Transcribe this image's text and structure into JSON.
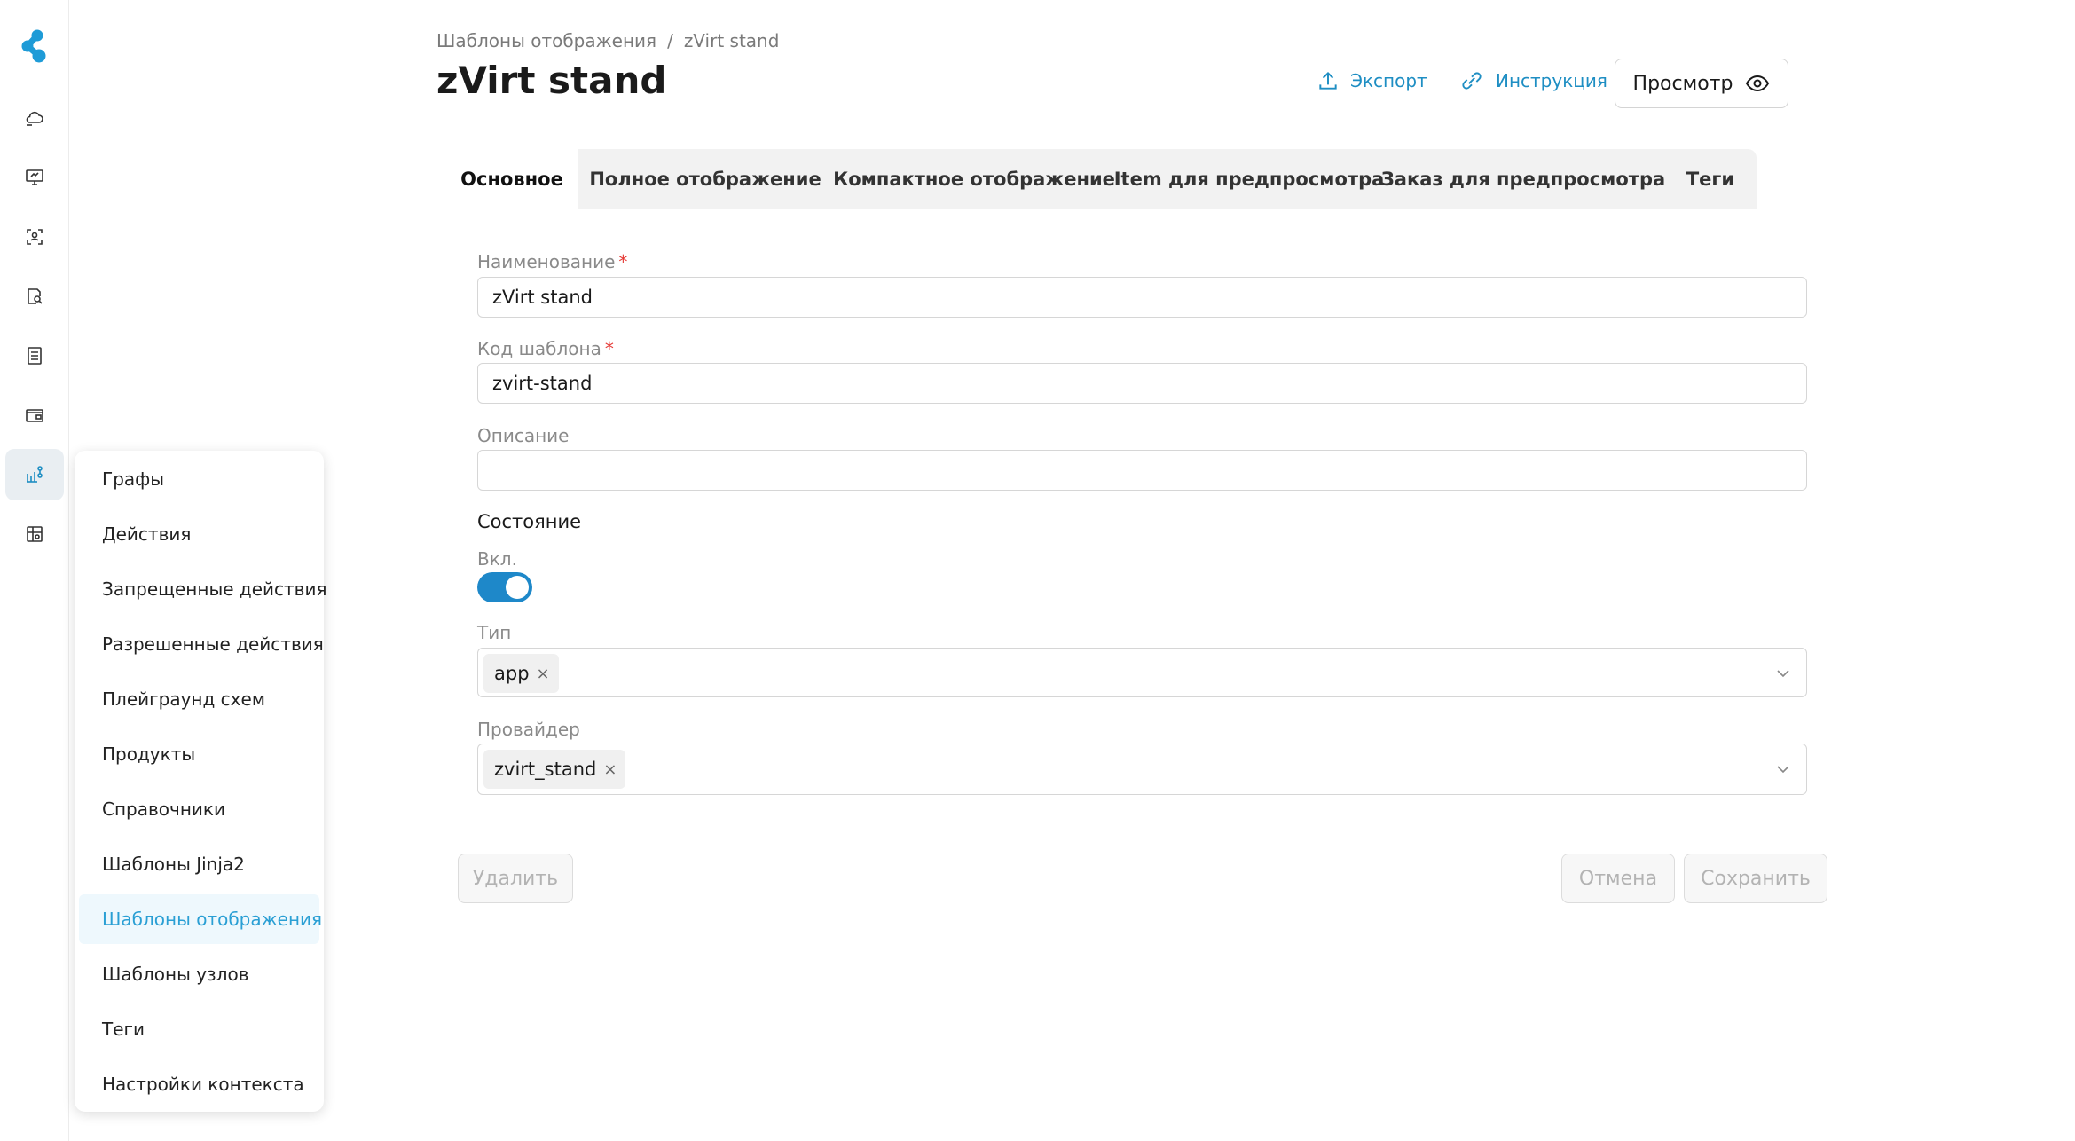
{
  "rail": {
    "items": [
      {
        "icon": "cloud-icon"
      },
      {
        "icon": "monitor-icon"
      },
      {
        "icon": "user-frame-icon"
      },
      {
        "icon": "document-search-icon"
      },
      {
        "icon": "list-icon"
      },
      {
        "icon": "wallet-icon"
      },
      {
        "icon": "chart-tree-icon",
        "active": true
      },
      {
        "icon": "grid-settings-icon"
      }
    ]
  },
  "flyout": {
    "items": [
      {
        "label": "Графы"
      },
      {
        "label": "Действия"
      },
      {
        "label": "Запрещенные действия"
      },
      {
        "label": "Разрешенные действия"
      },
      {
        "label": "Плейграунд схем"
      },
      {
        "label": "Продукты"
      },
      {
        "label": "Справочники"
      },
      {
        "label": "Шаблоны Jinja2"
      },
      {
        "label": "Шаблоны отображения",
        "active": true
      },
      {
        "label": "Шаблоны узлов"
      },
      {
        "label": "Теги"
      },
      {
        "label": "Настройки контекста"
      }
    ]
  },
  "breadcrumb": {
    "parent": "Шаблоны отображения",
    "separator": "/",
    "current": "zVirt stand"
  },
  "header": {
    "title": "zVirt stand",
    "export_label": "Экспорт",
    "instruction_label": "Инструкция",
    "preview_label": "Просмотр"
  },
  "tabs": [
    {
      "label": "Основное",
      "active": true
    },
    {
      "label": "Полное отображение"
    },
    {
      "label": "Компактное отображение"
    },
    {
      "label": "Item для предпросмотра"
    },
    {
      "label": "Заказ для предпросмотра"
    },
    {
      "label": "Теги"
    }
  ],
  "form": {
    "name_label": "Наименование",
    "name_value": "zVirt stand",
    "code_label": "Код шаблона",
    "code_value": "zvirt-stand",
    "required_mark": "*",
    "description_label": "Описание",
    "description_value": "",
    "state_title": "Состояние",
    "enabled_label": "Вкл.",
    "enabled": true,
    "type_label": "Тип",
    "type_chip": "app",
    "provider_label": "Провайдер",
    "provider_chip": "zvirt_stand",
    "chip_remove": "×"
  },
  "actions": {
    "delete_label": "Удалить",
    "cancel_label": "Отмена",
    "save_label": "Сохранить"
  },
  "colors": {
    "accent": "#1e8ec3",
    "toggle": "#1e88c9",
    "active_menu_text": "#2a9fd4"
  }
}
